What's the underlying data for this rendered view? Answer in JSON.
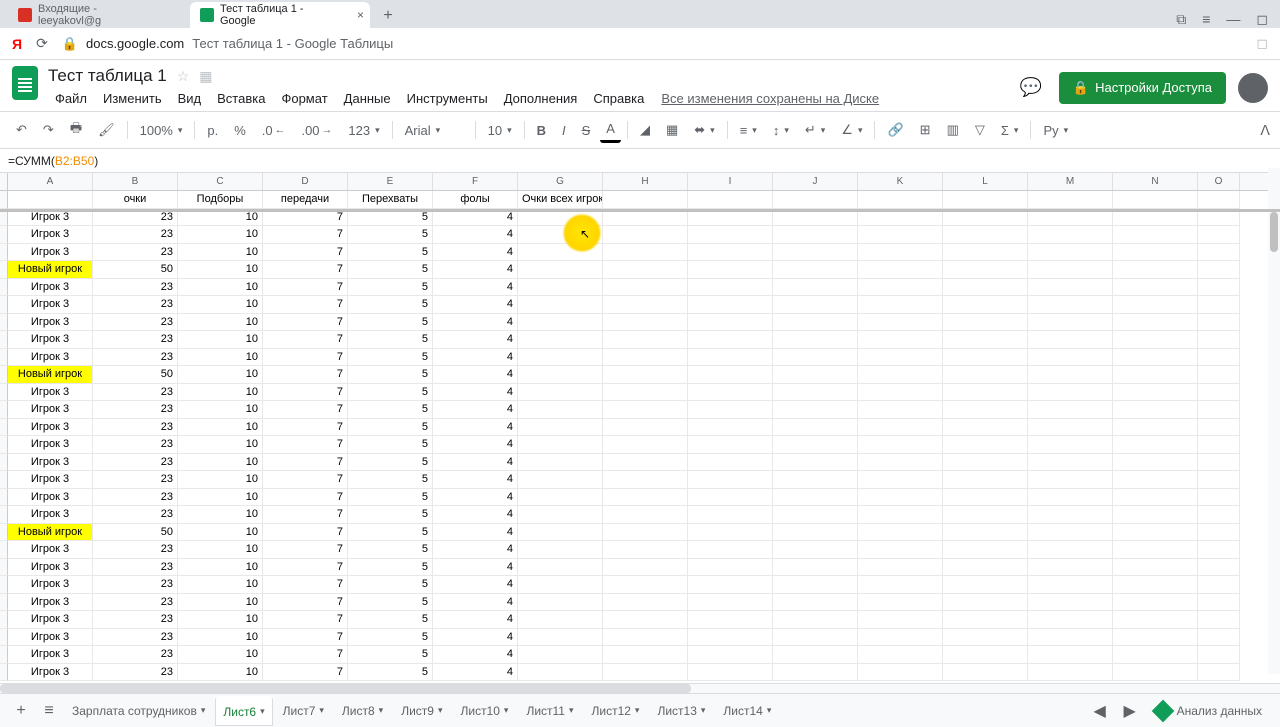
{
  "browser": {
    "tabs": [
      {
        "label": "Входящие - leeyakovl@g",
        "icon_color": "#d93025"
      },
      {
        "label": "Тест таблица 1 - Google",
        "icon_color": "#0f9d58"
      }
    ],
    "url_domain": "docs.google.com",
    "url_suffix": "Тест таблица 1 - Google Таблицы"
  },
  "doc": {
    "title": "Тест таблица 1",
    "menus": [
      "Файл",
      "Изменить",
      "Вид",
      "Вставка",
      "Формат",
      "Данные",
      "Инструменты",
      "Дополнения",
      "Справка"
    ],
    "save_status": "Все изменения сохранены на Диске",
    "share_label": "Настройки Доступа"
  },
  "toolbar": {
    "zoom": "100%",
    "currency": "р.",
    "percent": "%",
    "dec_less": ".0",
    "dec_more": ".00",
    "fmt": "123",
    "font": "Arial",
    "size": "10",
    "script": "Ру"
  },
  "formula": {
    "prefix": "=СУММ(",
    "range": "B2:B50",
    "suffix": ")"
  },
  "columns": [
    "A",
    "B",
    "C",
    "D",
    "E",
    "F",
    "G",
    "H",
    "I",
    "J",
    "K",
    "L",
    "M",
    "N",
    "O"
  ],
  "headers": [
    "",
    "очки",
    "Подборы",
    "передачи",
    "Перехваты",
    "фолы",
    "Очки всех игроков"
  ],
  "rows": [
    {
      "a": "Игрок 3",
      "b": 23,
      "c": 10,
      "d": 7,
      "e": 5,
      "f": 4,
      "hl": false
    },
    {
      "a": "Игрок 3",
      "b": 23,
      "c": 10,
      "d": 7,
      "e": 5,
      "f": 4,
      "hl": false
    },
    {
      "a": "Игрок 3",
      "b": 23,
      "c": 10,
      "d": 7,
      "e": 5,
      "f": 4,
      "hl": false
    },
    {
      "a": "Новый игрок",
      "b": 50,
      "c": 10,
      "d": 7,
      "e": 5,
      "f": 4,
      "hl": true
    },
    {
      "a": "Игрок 3",
      "b": 23,
      "c": 10,
      "d": 7,
      "e": 5,
      "f": 4,
      "hl": false
    },
    {
      "a": "Игрок 3",
      "b": 23,
      "c": 10,
      "d": 7,
      "e": 5,
      "f": 4,
      "hl": false
    },
    {
      "a": "Игрок 3",
      "b": 23,
      "c": 10,
      "d": 7,
      "e": 5,
      "f": 4,
      "hl": false
    },
    {
      "a": "Игрок 3",
      "b": 23,
      "c": 10,
      "d": 7,
      "e": 5,
      "f": 4,
      "hl": false
    },
    {
      "a": "Игрок 3",
      "b": 23,
      "c": 10,
      "d": 7,
      "e": 5,
      "f": 4,
      "hl": false
    },
    {
      "a": "Новый игрок",
      "b": 50,
      "c": 10,
      "d": 7,
      "e": 5,
      "f": 4,
      "hl": true
    },
    {
      "a": "Игрок 3",
      "b": 23,
      "c": 10,
      "d": 7,
      "e": 5,
      "f": 4,
      "hl": false
    },
    {
      "a": "Игрок 3",
      "b": 23,
      "c": 10,
      "d": 7,
      "e": 5,
      "f": 4,
      "hl": false
    },
    {
      "a": "Игрок 3",
      "b": 23,
      "c": 10,
      "d": 7,
      "e": 5,
      "f": 4,
      "hl": false
    },
    {
      "a": "Игрок 3",
      "b": 23,
      "c": 10,
      "d": 7,
      "e": 5,
      "f": 4,
      "hl": false
    },
    {
      "a": "Игрок 3",
      "b": 23,
      "c": 10,
      "d": 7,
      "e": 5,
      "f": 4,
      "hl": false
    },
    {
      "a": "Игрок 3",
      "b": 23,
      "c": 10,
      "d": 7,
      "e": 5,
      "f": 4,
      "hl": false
    },
    {
      "a": "Игрок 3",
      "b": 23,
      "c": 10,
      "d": 7,
      "e": 5,
      "f": 4,
      "hl": false
    },
    {
      "a": "Игрок 3",
      "b": 23,
      "c": 10,
      "d": 7,
      "e": 5,
      "f": 4,
      "hl": false
    },
    {
      "a": "Новый игрок",
      "b": 50,
      "c": 10,
      "d": 7,
      "e": 5,
      "f": 4,
      "hl": true
    },
    {
      "a": "Игрок 3",
      "b": 23,
      "c": 10,
      "d": 7,
      "e": 5,
      "f": 4,
      "hl": false
    },
    {
      "a": "Игрок 3",
      "b": 23,
      "c": 10,
      "d": 7,
      "e": 5,
      "f": 4,
      "hl": false
    },
    {
      "a": "Игрок 3",
      "b": 23,
      "c": 10,
      "d": 7,
      "e": 5,
      "f": 4,
      "hl": false
    },
    {
      "a": "Игрок 3",
      "b": 23,
      "c": 10,
      "d": 7,
      "e": 5,
      "f": 4,
      "hl": false
    },
    {
      "a": "Игрок 3",
      "b": 23,
      "c": 10,
      "d": 7,
      "e": 5,
      "f": 4,
      "hl": false
    },
    {
      "a": "Игрок 3",
      "b": 23,
      "c": 10,
      "d": 7,
      "e": 5,
      "f": 4,
      "hl": false
    },
    {
      "a": "Игрок 3",
      "b": 23,
      "c": 10,
      "d": 7,
      "e": 5,
      "f": 4,
      "hl": false
    },
    {
      "a": "Игрок 3",
      "b": 23,
      "c": 10,
      "d": 7,
      "e": 5,
      "f": 4,
      "hl": false
    }
  ],
  "sheets": {
    "tabs": [
      "Зарплата сотрудников",
      "Лист6",
      "Лист7",
      "Лист8",
      "Лист9",
      "Лист10",
      "Лист11",
      "Лист12",
      "Лист13",
      "Лист14"
    ],
    "active": 1,
    "explore": "Анализ данных"
  }
}
